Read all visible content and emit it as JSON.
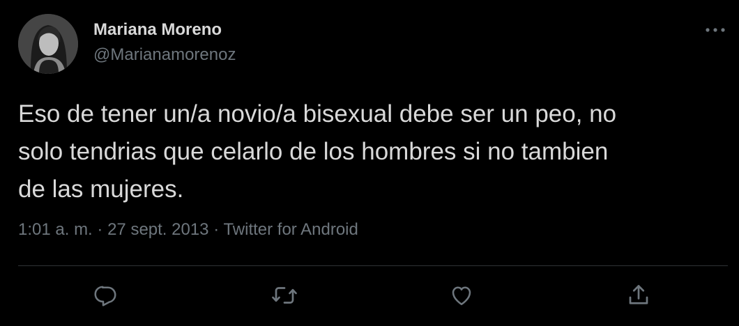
{
  "user": {
    "display_name": "Mariana Moreno",
    "handle": "@Marianamorenoz"
  },
  "tweet": {
    "text": "Eso de tener un/a novio/a bisexual debe ser un peo, no\nsolo tendrias que celarlo de los hombres si no tambien\nde las mujeres."
  },
  "meta": {
    "time": "1:01 a. m.",
    "separator": "·",
    "date": "27 sept. 2013",
    "source": "Twitter for Android"
  },
  "icons": {
    "more": "more-horizontal-icon",
    "reply": "reply-icon",
    "retweet": "retweet-icon",
    "like": "heart-icon",
    "share": "share-icon"
  },
  "colors": {
    "background": "#000000",
    "primary_text": "#d9d9d9",
    "secondary_text": "#6e767d",
    "divider": "#2f3336"
  }
}
